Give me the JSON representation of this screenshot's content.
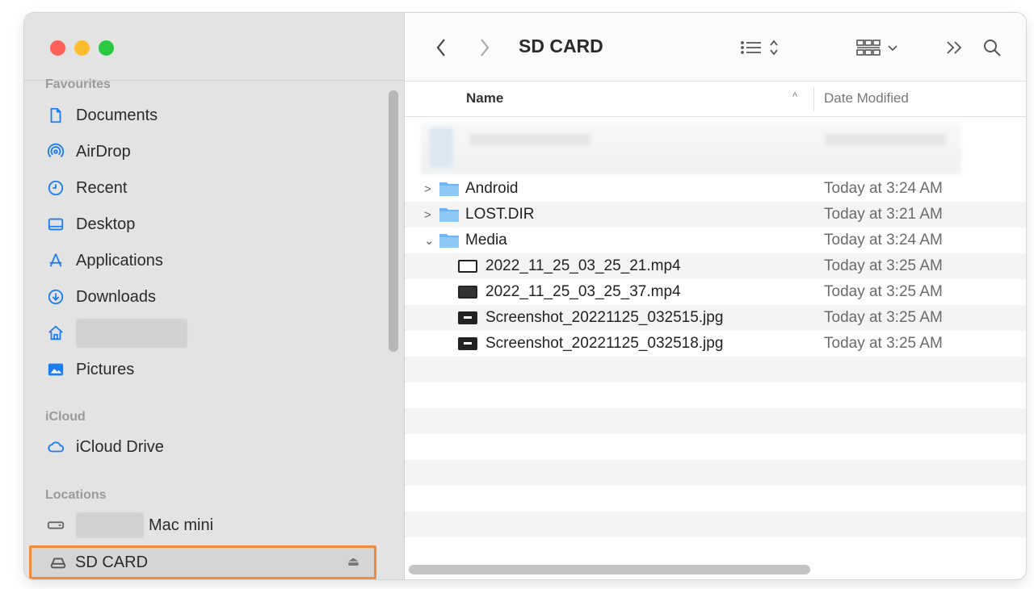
{
  "window": {
    "title": "SD CARD"
  },
  "sidebar": {
    "sections": {
      "favourites": "Favourites",
      "icloud": "iCloud",
      "locations": "Locations"
    },
    "favourites": [
      {
        "label": "Documents",
        "icon": "document-icon"
      },
      {
        "label": "AirDrop",
        "icon": "airdrop-icon"
      },
      {
        "label": "Recent",
        "icon": "clock-icon"
      },
      {
        "label": "Desktop",
        "icon": "desktop-icon"
      },
      {
        "label": "Applications",
        "icon": "applications-icon"
      },
      {
        "label": "Downloads",
        "icon": "download-icon"
      },
      {
        "label": "",
        "icon": "home-icon"
      },
      {
        "label": "Pictures",
        "icon": "pictures-icon"
      }
    ],
    "icloud": [
      {
        "label": "iCloud Drive",
        "icon": "cloud-icon"
      }
    ],
    "locations": [
      {
        "label": "Mac mini",
        "icon": "mac-mini-icon"
      },
      {
        "label": "SD CARD",
        "icon": "drive-icon"
      }
    ]
  },
  "toolbar": {
    "back_icon": "chevron-left-icon",
    "forward_icon": "chevron-right-icon",
    "view_icon": "list-view-icon",
    "group_icon": "group-icon",
    "more_icon": "more-icon",
    "search_icon": "search-icon"
  },
  "columns": {
    "name": "Name",
    "date": "Date Modified"
  },
  "rows": [
    {
      "name": "Android",
      "date": "Today at 3:24 AM",
      "type": "folder",
      "expanded": false
    },
    {
      "name": "LOST.DIR",
      "date": "Today at 3:21 AM",
      "type": "folder",
      "expanded": false
    },
    {
      "name": "Media",
      "date": "Today at 3:24 AM",
      "type": "folder",
      "expanded": true
    },
    {
      "name": "2022_11_25_03_25_21.mp4",
      "date": "Today at 3:25 AM",
      "type": "video"
    },
    {
      "name": "2022_11_25_03_25_37.mp4",
      "date": "Today at 3:25 AM",
      "type": "video-dark"
    },
    {
      "name": "Screenshot_20221125_032515.jpg",
      "date": "Today at 3:25 AM",
      "type": "image"
    },
    {
      "name": "Screenshot_20221125_032518.jpg",
      "date": "Today at 3:25 AM",
      "type": "image"
    }
  ],
  "colors": {
    "accent": "#1e7cf1",
    "highlight": "#f28a3b"
  }
}
